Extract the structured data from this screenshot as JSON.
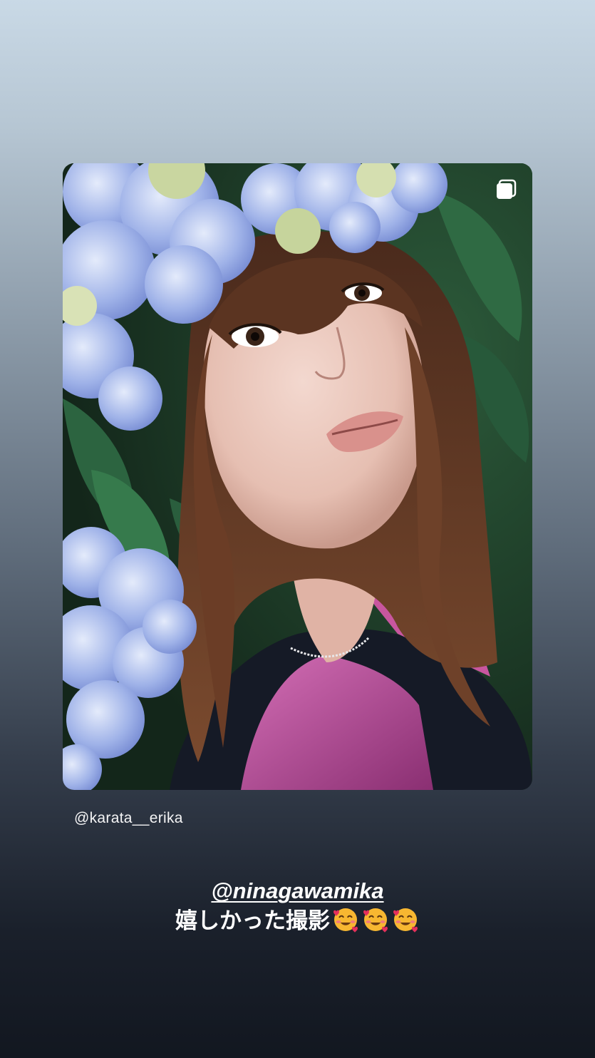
{
  "story": {
    "shared_post": {
      "author": "@karata__erika",
      "icons": {
        "multi_photo": "multiple-photos-icon"
      },
      "image_subject": "portrait with hydrangeas"
    },
    "caption": {
      "mention": "@ninagawamika",
      "text": "嬉しかった撮影",
      "emoji": [
        "smiling-face-with-hearts",
        "smiling-face-with-hearts",
        "smiling-face-with-hearts"
      ]
    }
  },
  "colors": {
    "gradient_top": "#c9d9e6",
    "gradient_bottom": "#121720",
    "text": "#ffffff"
  }
}
